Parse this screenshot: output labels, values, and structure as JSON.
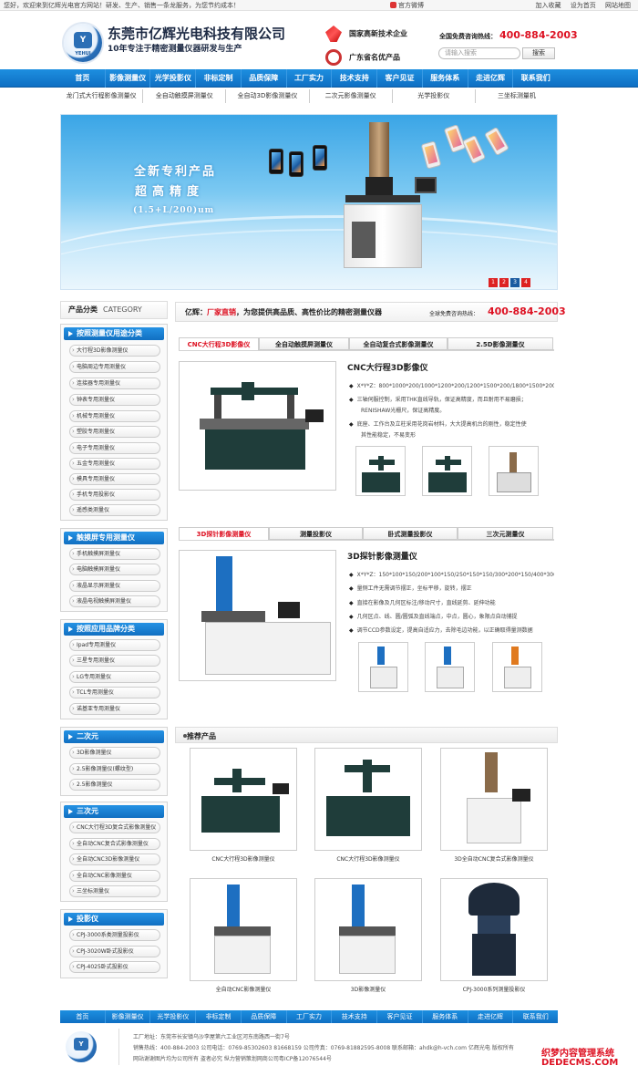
{
  "topbar": {
    "welcome": "您好，欢迎来到亿辉光电官方网站！研发、生产、销售一条龙服务，为您节约成本！",
    "weibo": "官方微博",
    "links": [
      "加入收藏",
      "设为首页",
      "网站地图"
    ]
  },
  "header": {
    "logo_text": "YEHUI",
    "company": "东莞市亿辉光电科技有限公司",
    "slogan": "10年专注于精密测量仪器研发与生产",
    "award1": "国家高新技术企业",
    "award2": "广东省名优产品",
    "hotline_label": "全国免费咨询热线：",
    "hotline": "400-884-2003",
    "search_placeholder": "请输入搜索",
    "search_button": "搜索"
  },
  "nav": [
    "首页",
    "影像测量仪",
    "光学投影仪",
    "非标定制",
    "品质保障",
    "工厂实力",
    "技术支持",
    "客户见证",
    "服务体系",
    "走进亿辉",
    "联系我们"
  ],
  "subnav": [
    "龙门式大行程影像测量仪",
    "全自动触摸屏测量仪",
    "全自动3D影像测量仪",
    "二次元影像测量仪",
    "光学投影仪",
    "三坐标测量机"
  ],
  "banner": {
    "line1": "全新专利产品",
    "line2": "超高精度",
    "line3": "(1.5+L/200)um",
    "dots": [
      "1",
      "2",
      "3",
      "4"
    ]
  },
  "sidebar": {
    "title": "产品分类",
    "title_en": "CATEGORY",
    "groups": [
      {
        "title": "按照测量仪用途分类",
        "items": [
          "大行程3D影像测量仪",
          "电脑周边专用测量仪",
          "连接器专用测量仪",
          "钟表专用测量仪",
          "机械专用测量仪",
          "塑胶专用测量仪",
          "电子专用测量仪",
          "五金专用测量仪",
          "模具专用测量仪",
          "手机专用投影仪",
          "遥感类测量仪"
        ]
      },
      {
        "title": "触摸屏专用测量仪",
        "items": [
          "手机触摸屏测量仪",
          "电脑触摸屏测量仪",
          "液晶显示屏测量仪",
          "液晶电视触摸屏测量仪"
        ]
      },
      {
        "title": "按照应用品牌分类",
        "items": [
          "Ipad专用测量仪",
          "三星专用测量仪",
          "LG专用测量仪",
          "TCL专用测量仪",
          "诺基亚专用测量仪"
        ]
      },
      {
        "title": "二次元",
        "items": [
          "3D影像测量仪",
          "2.5影像测量仪(螺纹型)",
          "2.5影像测量仪"
        ]
      },
      {
        "title": "三次元",
        "items": [
          "CNC大行程3D复合式影像测量仪",
          "全自动CNC复合式影像测量仪",
          "全自动CNC3D影像测量仪",
          "全自动CNC影像测量仪",
          "三坐标测量仪"
        ]
      },
      {
        "title": "投影仪",
        "items": [
          "CPJ-3000系类测量投影仪",
          "CPJ-3020W卧式投影仪",
          "CPJ-4025卧式投影仪"
        ]
      }
    ]
  },
  "bar": {
    "brand": "亿辉：",
    "highlight": "厂家直销",
    "rest": "，为您提供高品质、高性价比的精密测量仪器",
    "tag": "全球免费咨询热线：",
    "num": "400-884-2003"
  },
  "section1": {
    "tabs": [
      "CNC大行程3D影像仪",
      "全自动触摸屏测量仪",
      "全自动复合式影像测量仪",
      "2.5D影像测量仪"
    ],
    "title": "CNC大行程3D影像仪",
    "lines": [
      "X*Y*Z：800*1000*200/1000*1200*200/1200*1500*200/1800*1500*200",
      "三轴伺服控制，采用THK直线导轨，保证高精度，而且耐用不易磨损；",
      "RENISHAW光栅尺，保证高精度。",
      "底座、工作台及立柱采用花岗岩材料，大大提高机台的刚性，稳定性使",
      "其性能稳定，不易变形"
    ]
  },
  "section2": {
    "tabs": [
      "3D探针影像测量仪",
      "测量投影仪",
      "卧式测量投影仪",
      "三次元测量仪"
    ],
    "title": "3D探针影像测量仪",
    "lines": [
      "X*Y*Z：150*100*150/200*100*150/250*150*150/300*200*150/400*300*150",
      "量侧工件无需调节摆正，坐标平移，旋转，摆正",
      "直接在影像及几何区标注/移动尺寸，直线延剪、延伸功能",
      "几何区点、线、圆/圆弧及直线端点，中点，圆心，象限点自动捕捉",
      "调节CCD参数设定，提高自适应力，去除毛边功能，以正确取得量测数据"
    ]
  },
  "recommend": {
    "title": "推荐产品",
    "items": [
      "CNC大行程3D影像测量仪",
      "CNC大行程3D影像测量仪",
      "3D全自动CNC复合式影像测量仪",
      "全自动CNC影像测量仪",
      "3D影像测量仪",
      "CPJ-3000系列测量投影仪"
    ]
  },
  "footer": {
    "nav": [
      "首页",
      "影像测量仪",
      "光学投影仪",
      "非标定制",
      "品质保障",
      "工厂实力",
      "技术支持",
      "客户见证",
      "服务体系",
      "走进亿辉",
      "联系我们"
    ],
    "line1": "工厂地址：东莞市长安镇乌沙李屋第六工业区河东南路西一街7号",
    "line2": "销售热线：400-884-2003  公司电话：0769-85302603 81668159  公司传真：0769-81882595-8008  联系邮箱：ahdk@h-vch.com  亿辉光电  版权所有",
    "line3": "网站谢谢图片均为公司所有 盗者必究  纵力营销策划网商公司粤ICP备12076544号"
  },
  "watermark": {
    "line1": "织梦内容管理系统",
    "line2": "DEDECMS.COM"
  }
}
